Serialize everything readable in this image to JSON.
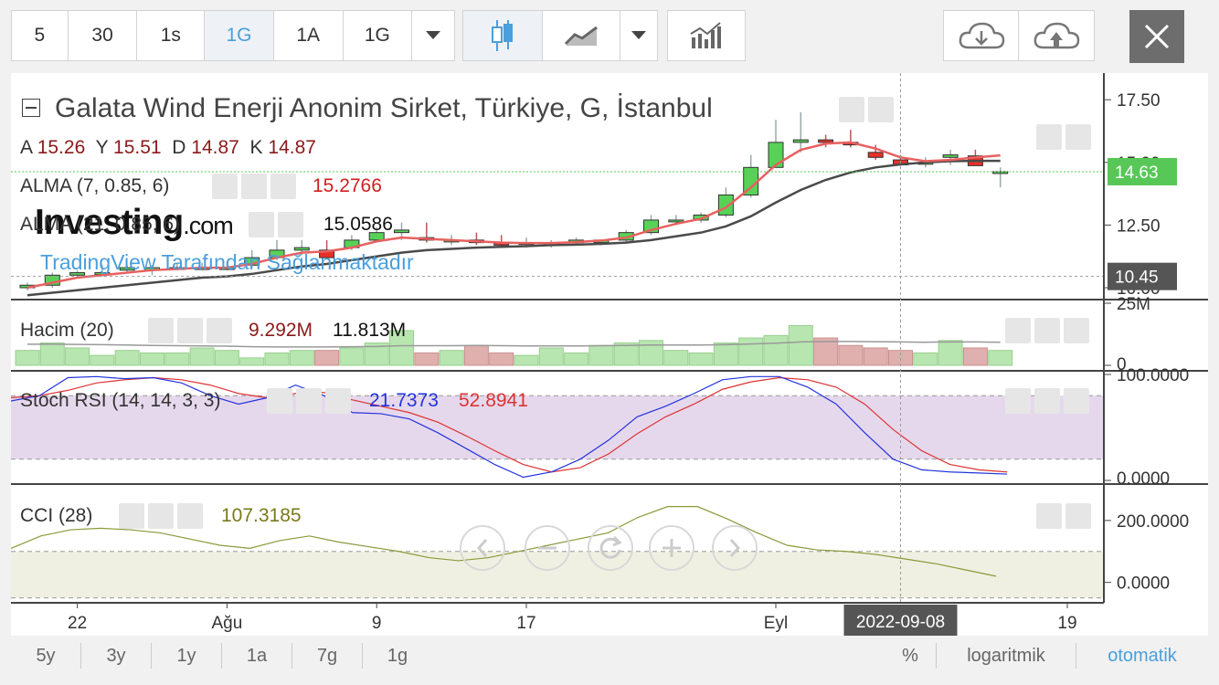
{
  "toolbar": {
    "intervals": [
      "5",
      "30",
      "1s",
      "1G",
      "1A",
      "1G"
    ],
    "selected_interval": "1G"
  },
  "legend": {
    "title": "Galata Wind Enerji Anonim Sirket, Türkiye, G, İstanbul",
    "ohlc": [
      {
        "key": "A",
        "value": "15.26"
      },
      {
        "key": "Y",
        "value": "15.51"
      },
      {
        "key": "D",
        "value": "14.87"
      },
      {
        "key": "K",
        "value": "14.87"
      }
    ],
    "alma1": {
      "label": "ALMA (7, 0.85, 6)",
      "value": "15.2766"
    },
    "alma2": {
      "label": "ALMA (21, 0.85, 6)",
      "value": "15.0586"
    },
    "volume": {
      "label": "Hacim (20)",
      "value1": "9.292M",
      "value2": "11.813M"
    },
    "stoch": {
      "label": "Stoch RSI (14, 14, 3, 3)",
      "value1": "21.7373",
      "value2": "52.8941"
    },
    "cci": {
      "label": "CCI (28)",
      "value": "107.3185"
    }
  },
  "watermark": {
    "brand": "Investing",
    "brand_suffix": ".com",
    "credit": "TradingView Tarafından Sağlanmaktadır"
  },
  "price_axis": {
    "ticks": [
      "17.50",
      "15.00",
      "12.50",
      "10.00"
    ],
    "last_price": "14.63",
    "crosshair_price": "10.45"
  },
  "volume_axis": {
    "ticks": [
      "25M",
      "0"
    ]
  },
  "stoch_axis": {
    "ticks": [
      "100.0000",
      "0.0000"
    ]
  },
  "cci_axis": {
    "ticks": [
      "200.0000",
      "0.0000"
    ]
  },
  "time_axis": {
    "ticks": [
      "22",
      "Ağu",
      "9",
      "17",
      "Eyl",
      "19"
    ],
    "crosshair_date": "2022-09-08"
  },
  "ranges": [
    "5y",
    "3y",
    "1y",
    "1a",
    "7g",
    "1g"
  ],
  "scale_options": {
    "percent": "%",
    "log": "logaritmik",
    "auto": "otomatik"
  },
  "colors": {
    "up": "#57d257",
    "down": "#e8302a",
    "alma_fast": "#e86060",
    "alma_slow": "#4a4a4a",
    "stoch_k": "#2233dd",
    "stoch_d": "#dd3333",
    "cci": "#8a9a3a",
    "accent": "#4a9fdc",
    "last_price": "#57c857"
  },
  "chart_data": [
    {
      "type": "candlestick",
      "title": "Galata Wind Enerji Anonim Sirket, Türkiye, G, İstanbul",
      "x": [
        "2022-07-20",
        "2022-07-21",
        "2022-07-22",
        "2022-07-25",
        "2022-07-26",
        "2022-07-27",
        "2022-07-28",
        "2022-07-29",
        "2022-08-01",
        "2022-08-02",
        "2022-08-03",
        "2022-08-04",
        "2022-08-05",
        "2022-08-08",
        "2022-08-09",
        "2022-08-10",
        "2022-08-11",
        "2022-08-12",
        "2022-08-15",
        "2022-08-16",
        "2022-08-17",
        "2022-08-18",
        "2022-08-19",
        "2022-08-22",
        "2022-08-23",
        "2022-08-24",
        "2022-08-25",
        "2022-08-26",
        "2022-08-29",
        "2022-08-31",
        "2022-09-01",
        "2022-09-02",
        "2022-09-05",
        "2022-09-06",
        "2022-09-07",
        "2022-09-08",
        "2022-09-09",
        "2022-09-12",
        "2022-09-13",
        "2022-09-14"
      ],
      "open": [
        10.0,
        10.1,
        10.5,
        10.6,
        10.7,
        10.7,
        10.8,
        10.8,
        10.8,
        10.9,
        11.2,
        11.5,
        11.5,
        11.6,
        11.9,
        12.2,
        12.0,
        11.9,
        11.9,
        11.8,
        11.8,
        11.7,
        11.8,
        11.8,
        11.9,
        12.2,
        12.7,
        12.7,
        12.9,
        13.7,
        14.8,
        15.8,
        15.9,
        15.8,
        15.4,
        15.1,
        15.0,
        15.2,
        15.26,
        14.6
      ],
      "high": [
        10.2,
        10.6,
        10.7,
        10.9,
        10.9,
        10.9,
        11.0,
        11.0,
        11.0,
        11.5,
        11.9,
        11.9,
        11.9,
        12.1,
        12.4,
        12.6,
        12.6,
        12.1,
        12.2,
        12.1,
        12.0,
        11.9,
        12.0,
        11.9,
        12.3,
        12.9,
        12.9,
        13.0,
        14.0,
        15.3,
        16.7,
        17.0,
        16.1,
        16.3,
        15.7,
        15.3,
        15.2,
        15.5,
        15.51,
        14.8
      ],
      "low": [
        9.9,
        10.0,
        10.4,
        10.5,
        10.6,
        10.5,
        10.7,
        10.7,
        10.7,
        10.8,
        11.1,
        11.3,
        11.3,
        11.5,
        11.8,
        11.9,
        11.8,
        11.7,
        11.7,
        11.6,
        11.6,
        11.6,
        11.7,
        11.7,
        11.8,
        12.1,
        12.5,
        12.6,
        12.8,
        13.6,
        14.8,
        15.4,
        15.6,
        15.6,
        15.1,
        14.9,
        14.8,
        14.9,
        14.87,
        14.0
      ],
      "close": [
        10.1,
        10.5,
        10.6,
        10.6,
        10.8,
        10.8,
        10.8,
        10.8,
        10.8,
        11.2,
        11.5,
        11.6,
        11.2,
        11.9,
        12.2,
        12.3,
        11.9,
        11.9,
        11.8,
        11.7,
        11.8,
        11.8,
        11.9,
        11.9,
        12.2,
        12.7,
        12.7,
        12.9,
        13.7,
        14.8,
        15.8,
        15.9,
        15.8,
        15.7,
        15.2,
        14.9,
        15.0,
        15.3,
        14.87,
        14.63
      ],
      "alma_fast": [
        10.0,
        10.2,
        10.4,
        10.5,
        10.6,
        10.7,
        10.75,
        10.8,
        10.8,
        10.95,
        11.2,
        11.4,
        11.45,
        11.6,
        11.85,
        12.0,
        11.95,
        11.9,
        11.85,
        11.8,
        11.78,
        11.78,
        11.82,
        11.88,
        12.0,
        12.3,
        12.55,
        12.75,
        13.2,
        14.0,
        14.9,
        15.5,
        15.75,
        15.8,
        15.55,
        15.2,
        15.05,
        15.1,
        15.2,
        15.28
      ],
      "alma_slow": [
        9.7,
        9.8,
        9.9,
        10.0,
        10.1,
        10.2,
        10.3,
        10.4,
        10.45,
        10.55,
        10.7,
        10.85,
        10.95,
        11.1,
        11.25,
        11.4,
        11.5,
        11.55,
        11.6,
        11.63,
        11.66,
        11.7,
        11.72,
        11.75,
        11.8,
        11.9,
        12.05,
        12.2,
        12.45,
        12.85,
        13.4,
        13.9,
        14.3,
        14.6,
        14.8,
        14.92,
        15.0,
        15.05,
        15.06,
        15.06
      ],
      "ylim": [
        9.6,
        18.2
      ],
      "last_price": 14.63,
      "crosshair_price": 10.45
    },
    {
      "type": "bar",
      "title": "Hacim (20)",
      "x": "same as candlestick",
      "values": [
        6,
        9,
        7,
        4,
        6,
        5,
        5,
        7,
        6,
        3,
        5,
        6,
        6,
        7,
        9,
        14,
        5,
        6,
        8,
        5,
        4,
        7,
        5,
        8,
        9,
        10,
        6,
        5,
        9,
        11,
        12,
        16,
        11,
        8,
        7,
        6,
        5,
        10,
        7,
        6
      ],
      "volume_ma": [
        8.5,
        8.5,
        8.4,
        8.3,
        8.2,
        8.0,
        7.9,
        7.8,
        7.7,
        7.5,
        7.4,
        7.4,
        7.4,
        7.5,
        7.6,
        7.9,
        7.9,
        7.9,
        8.0,
        7.9,
        7.8,
        7.8,
        7.8,
        7.9,
        8.0,
        8.2,
        8.2,
        8.2,
        8.3,
        8.6,
        8.9,
        9.4,
        9.6,
        9.6,
        9.5,
        9.4,
        9.3,
        9.4,
        9.4,
        9.3
      ],
      "ylim": [
        0,
        25
      ]
    },
    {
      "type": "line",
      "title": "Stoch RSI (14, 14, 3, 3)",
      "series": [
        {
          "values": [
            75,
            80,
            97,
            98,
            96,
            97,
            92,
            80,
            72,
            78,
            90,
            80,
            64,
            63,
            58,
            45,
            30,
            15,
            3,
            8,
            20,
            38,
            60,
            70,
            82,
            95,
            98,
            98,
            88,
            72,
            45,
            20,
            10,
            8,
            7,
            6
          ]
        },
        {
          "values": [
            78,
            80,
            85,
            92,
            95,
            97,
            95,
            90,
            82,
            78,
            82,
            83,
            76,
            70,
            64,
            55,
            42,
            28,
            15,
            8,
            12,
            25,
            44,
            60,
            72,
            86,
            93,
            97,
            95,
            88,
            72,
            48,
            28,
            15,
            10,
            8
          ]
        }
      ],
      "ylim": [
        0,
        100
      ],
      "bands": [
        20,
        80
      ]
    },
    {
      "type": "line",
      "title": "CCI (28)",
      "series": [
        {
          "values": [
            110,
            150,
            170,
            175,
            170,
            160,
            140,
            120,
            110,
            135,
            150,
            130,
            115,
            100,
            80,
            70,
            80,
            100,
            120,
            140,
            160,
            210,
            245,
            245,
            205,
            160,
            120,
            105,
            100,
            90,
            75,
            60,
            40,
            20
          ]
        }
      ],
      "ylim": [
        -60,
        300
      ],
      "bands": [
        -50,
        100
      ]
    }
  ]
}
